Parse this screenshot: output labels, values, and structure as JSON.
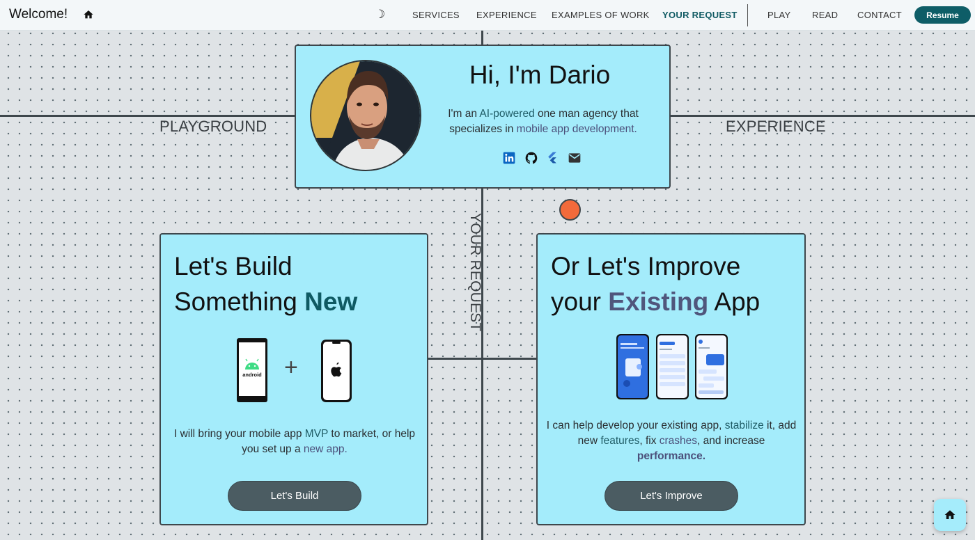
{
  "nav": {
    "brand": "Welcome!",
    "home_icon": "home-icon",
    "theme_icon": "moon-icon",
    "items": [
      {
        "label": "SERVICES"
      },
      {
        "label": "EXPERIENCE"
      },
      {
        "label": "EXAMPLES OF WORK"
      },
      {
        "label": "YOUR REQUEST",
        "active": true
      },
      {
        "label": "PLAY"
      },
      {
        "label": "READ"
      },
      {
        "label": "CONTACT"
      }
    ],
    "resume_label": "Resume"
  },
  "quadrants": {
    "left": "PLAYGROUND",
    "right": "EXPERIENCE",
    "center": "YOUR REQUEST"
  },
  "hero": {
    "title": "Hi, I'm Dario",
    "desc_1": "I'm an ",
    "desc_hl1": "AI-powered",
    "desc_2": " one man agency that specializes in ",
    "desc_hl2": "mobile app development.",
    "socials": [
      "linkedin-icon",
      "github-icon",
      "flutter-icon",
      "mail-icon"
    ]
  },
  "build": {
    "title_1": "Let's Build",
    "title_2": "Something ",
    "title_accent": "New",
    "plus": "+",
    "desc_1": "I will bring your mobile app ",
    "desc_hl1": "MVP",
    "desc_2": " to market, or help you set up a ",
    "desc_hl2": "new app.",
    "cta": "Let's Build"
  },
  "improve": {
    "title_1": "Or Let's Improve",
    "title_2": "your ",
    "title_accent": "Existing",
    "title_3": " App",
    "desc_1": "I can help develop your existing app, ",
    "desc_hl1": "stabilize",
    "desc_2": " it, add new ",
    "desc_hl2": "features",
    "desc_3": ", fix ",
    "desc_hl3": "crashes",
    "desc_4": ", and increase ",
    "desc_hl4": "performance.",
    "cta": "Let's Improve"
  },
  "colors": {
    "card_bg": "#a4ecfb",
    "accent_teal": "#0f5a63",
    "accent_indigo": "#50567c",
    "cta_bg": "#4b5c62",
    "orange_dot": "#f26a3b"
  }
}
